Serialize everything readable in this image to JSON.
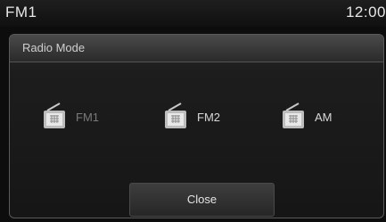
{
  "status_bar": {
    "title": "FM1",
    "clock": "12:00"
  },
  "dialog": {
    "title": "Radio Mode",
    "options": [
      {
        "label": "FM1",
        "icon": "radio-icon",
        "selected": true
      },
      {
        "label": "FM2",
        "icon": "radio-icon",
        "selected": false
      },
      {
        "label": "AM",
        "icon": "radio-icon",
        "selected": false
      }
    ],
    "close_label": "Close"
  },
  "colors": {
    "background": "#0d0d0d",
    "text": "#e6e6e6",
    "selected_label": "#7a7a7a"
  }
}
